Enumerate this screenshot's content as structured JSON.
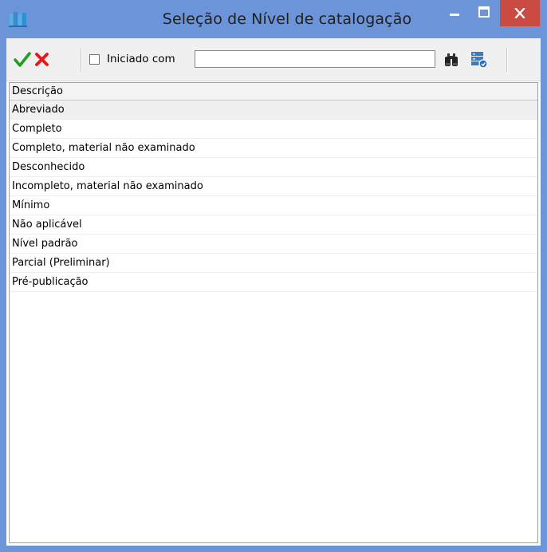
{
  "window": {
    "title": "Seleção de Nível de catalogação",
    "controls": {
      "minimize": "minimize-icon",
      "maximize": "maximize-icon",
      "close": "close-icon"
    }
  },
  "toolbar": {
    "confirm_icon": "checkmark-icon",
    "cancel_icon": "x-icon",
    "starts_with_label": "Iniciado com",
    "starts_with_checked": false,
    "search_value": "",
    "search_icon": "binoculars-icon",
    "database_icon": "database-icon"
  },
  "grid": {
    "column_header": "Descrição",
    "selected_index": 0,
    "rows": [
      "Abreviado",
      "Completo",
      "Completo, material não examinado",
      "Desconhecido",
      "Incompleto, material não examinado",
      "Mínimo",
      "Não aplicável",
      "Nível padrão",
      "Parcial (Preliminar)",
      "Pré-publicação"
    ]
  },
  "colors": {
    "titlebar": "#6b95d8",
    "close_button": "#c94b42",
    "confirm_green": "#1e9e1e",
    "cancel_red": "#e01b1b"
  }
}
